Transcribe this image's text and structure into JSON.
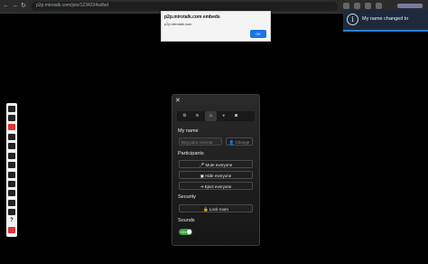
{
  "browser": {
    "back_glyph": "←",
    "forward_glyph": "→",
    "reload_glyph": "↻",
    "url": "p2p.mirotalk.com/join/1234234sdfsd"
  },
  "alert": {
    "title": "p2p.mirotalk.com embeds",
    "message": "p2p.mirotalk.com",
    "ok_label": "OK"
  },
  "toast": {
    "icon": "info-icon",
    "icon_glyph": "i",
    "text": "My name changed to"
  },
  "toolbar": {
    "items": [
      "screen-share-icon",
      "microphone-icon",
      "video-camera-off-icon",
      "record-icon",
      "chat-icon",
      "emoji-icon",
      "whiteboard-icon",
      "file-share-icon",
      "participants-icon",
      "settings-icon",
      "fullscreen-icon",
      "grid-icon",
      "help-icon",
      "leave-icon"
    ]
  },
  "settings_panel": {
    "close_glyph": "✕",
    "tabs": [
      {
        "icon": "gear-icon",
        "glyph": "⚙"
      },
      {
        "icon": "wifi-icon",
        "glyph": "≋"
      },
      {
        "icon": "home-icon",
        "glyph": "⌂",
        "active": true
      },
      {
        "icon": "palette-icon",
        "glyph": "◕"
      },
      {
        "icon": "camera-icon",
        "glyph": "◙"
      }
    ],
    "my_name_label": "My name",
    "name_placeholder": "Beg para nomear",
    "change_label": "Change",
    "participants_label": "Participants",
    "mute_everyone": "Mute everyone",
    "hide_everyone": "Hide everyone",
    "eject_everyone": "Eject everyone",
    "security_label": "Security",
    "lock_room": "Lock room",
    "sounds_label": "Sounds",
    "sounds_on": true,
    "toggle_text": "ON"
  },
  "colors": {
    "accent": "#1a73e8",
    "toggle_on": "#3f9a43",
    "toast_bg": "#1e2a3c",
    "danger": "#dd3333"
  }
}
